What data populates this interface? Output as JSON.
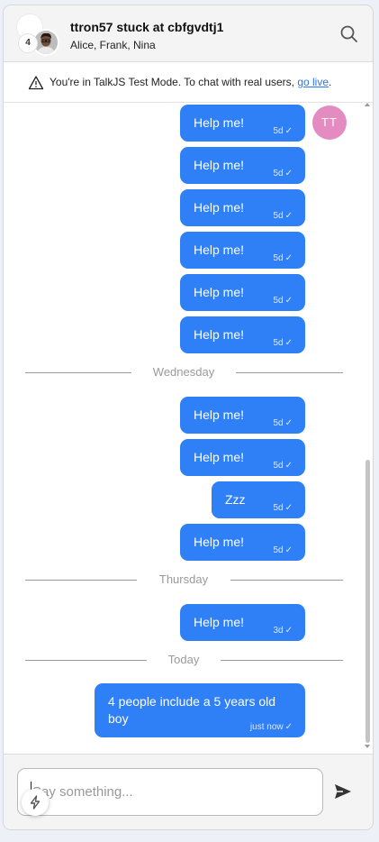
{
  "header": {
    "title": "ttron57 stuck at cbfgvdtj1",
    "subtitle": "Alice, Frank, Nina",
    "participant_count": "4",
    "search_icon": "search-icon"
  },
  "banner": {
    "text": "You're in TalkJS Test Mode. To chat with real users, ",
    "link_text": "go live",
    "period": ".",
    "icon": "warning-icon"
  },
  "messages": [
    {
      "text": "Help me!",
      "time": "5d"
    },
    {
      "text": "Help me!",
      "time": "5d"
    },
    {
      "text": "Help me!",
      "time": "5d"
    },
    {
      "text": "Help me!",
      "time": "5d"
    },
    {
      "text": "Help me!",
      "time": "5d"
    },
    {
      "text": "Help me!",
      "time": "5d"
    },
    {
      "text": "Help me!",
      "time": "5d"
    },
    {
      "text": "Help me!",
      "time": "5d"
    },
    {
      "text": "Zzz",
      "time": "5d"
    },
    {
      "text": "Help me!",
      "time": "5d"
    },
    {
      "text": "Help me!",
      "time": "3d"
    },
    {
      "text": "4 people include a 5 years old boy",
      "time": "just now"
    }
  ],
  "sender_avatar": {
    "initials": "TT",
    "color": "#e48cc2"
  },
  "separators": [
    "Wednesday",
    "Thursday",
    "Today"
  ],
  "composer": {
    "placeholder": "Say something...",
    "send_icon": "send-icon",
    "action_icon": "lightning-icon"
  },
  "colors": {
    "bubble": "#2f7ff6",
    "link": "#2b76e8"
  }
}
